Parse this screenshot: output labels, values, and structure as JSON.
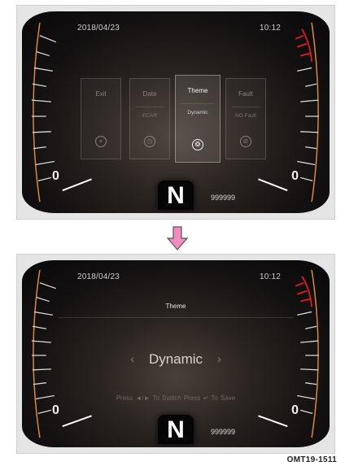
{
  "top_screen": {
    "date": "2018/04/23",
    "time": "10:12",
    "left_gauge_zero": "0",
    "right_gauge_zero": "0",
    "gear": "N",
    "odometer": "999999",
    "menu": [
      {
        "label": "Exit",
        "sub": "",
        "icon": "plus-circle-icon"
      },
      {
        "label": "Date",
        "sub": "ECAR",
        "icon": "clock-icon"
      },
      {
        "label": "Theme",
        "sub": "Dynamic",
        "icon": "palette-icon",
        "selected": true
      },
      {
        "label": "Fault",
        "sub": "NO Fault",
        "icon": "wrench-icon"
      }
    ]
  },
  "bottom_screen": {
    "date": "2018/04/23",
    "time": "10:12",
    "title": "Theme",
    "option": "Dynamic",
    "prev_arrow": "‹",
    "next_arrow": "›",
    "hint": "Press ◄/► To Switch   Press ↵ To Save",
    "left_gauge_zero": "0",
    "right_gauge_zero": "0",
    "gear": "N",
    "odometer": "999999"
  },
  "caption": "OMT19-1511",
  "colors": {
    "arrow_fill": "#f08cc0",
    "redline": "#cc1f1f",
    "gauge_arc": "#d98a3a"
  }
}
